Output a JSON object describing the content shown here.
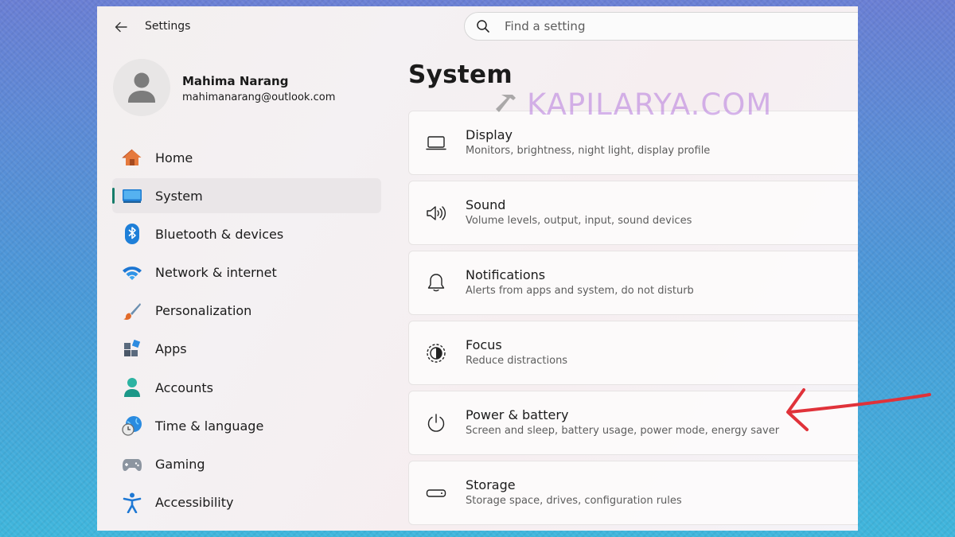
{
  "window": {
    "title": "Settings"
  },
  "search": {
    "placeholder": "Find a setting"
  },
  "user": {
    "name": "Mahima Narang",
    "email": "mahimanarang@outlook.com"
  },
  "nav": {
    "items": [
      {
        "label": "Home",
        "icon": "home-icon"
      },
      {
        "label": "System",
        "icon": "monitor-icon",
        "active": true
      },
      {
        "label": "Bluetooth & devices",
        "icon": "bluetooth-icon"
      },
      {
        "label": "Network & internet",
        "icon": "wifi-icon"
      },
      {
        "label": "Personalization",
        "icon": "paintbrush-icon"
      },
      {
        "label": "Apps",
        "icon": "apps-icon"
      },
      {
        "label": "Accounts",
        "icon": "accounts-icon"
      },
      {
        "label": "Time & language",
        "icon": "globe-clock-icon"
      },
      {
        "label": "Gaming",
        "icon": "gamepad-icon"
      },
      {
        "label": "Accessibility",
        "icon": "accessibility-icon"
      }
    ]
  },
  "main": {
    "title": "System",
    "cards": [
      {
        "title": "Display",
        "subtitle": "Monitors, brightness, night light, display profile",
        "icon": "laptop-icon"
      },
      {
        "title": "Sound",
        "subtitle": "Volume levels, output, input, sound devices",
        "icon": "speaker-icon"
      },
      {
        "title": "Notifications",
        "subtitle": "Alerts from apps and system, do not disturb",
        "icon": "bell-icon"
      },
      {
        "title": "Focus",
        "subtitle": "Reduce distractions",
        "icon": "focus-icon"
      },
      {
        "title": "Power & battery",
        "subtitle": "Screen and sleep, battery usage, power mode, energy saver",
        "icon": "power-icon"
      },
      {
        "title": "Storage",
        "subtitle": "Storage space, drives, configuration rules",
        "icon": "storage-icon"
      }
    ]
  },
  "watermark": {
    "text": "KAPILARYA.COM"
  },
  "colors": {
    "accent": "#167c6a",
    "annotation_arrow": "#e0323a"
  }
}
